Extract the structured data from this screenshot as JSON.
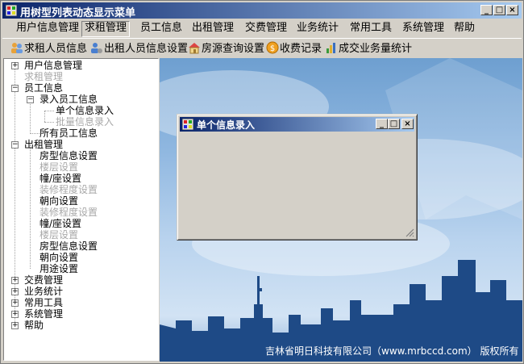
{
  "window": {
    "title": "用树型列表动态显示菜单"
  },
  "menu": [
    "用户信息管理",
    "求租管理",
    "员工信息",
    "出租管理",
    "交费管理",
    "业务统计",
    "常用工具",
    "系统管理",
    "帮助"
  ],
  "toolbar": [
    "求租人员信息",
    "出租人员信息设置",
    "房源查询设置",
    "收费记录",
    "成交业务量统计"
  ],
  "tree": [
    {
      "label": "用户信息管理",
      "disabled": false
    },
    {
      "label": "求租管理",
      "disabled": true
    },
    {
      "label": "员工信息",
      "disabled": false
    },
    {
      "label": "录入员工信息",
      "disabled": false
    },
    {
      "label": "单个信息录入",
      "disabled": false
    },
    {
      "label": "批量信息录入",
      "disabled": true
    },
    {
      "label": "所有员工信息",
      "disabled": false
    },
    {
      "label": "出租管理",
      "disabled": false
    },
    {
      "label": "房型信息设置",
      "disabled": false
    },
    {
      "label": "楼层设置",
      "disabled": true
    },
    {
      "label": "幢/座设置",
      "disabled": false
    },
    {
      "label": "装修程度设置",
      "disabled": true
    },
    {
      "label": "朝向设置",
      "disabled": false
    },
    {
      "label": "装修程度设置",
      "disabled": true
    },
    {
      "label": "幢/座设置",
      "disabled": false
    },
    {
      "label": "楼层设置",
      "disabled": true
    },
    {
      "label": "房型信息设置",
      "disabled": false
    },
    {
      "label": "朝向设置",
      "disabled": false
    },
    {
      "label": "用途设置",
      "disabled": false
    },
    {
      "label": "交费管理",
      "disabled": false
    },
    {
      "label": "业务统计",
      "disabled": false
    },
    {
      "label": "常用工具",
      "disabled": false
    },
    {
      "label": "系统管理",
      "disabled": false
    },
    {
      "label": "帮助",
      "disabled": false
    }
  ],
  "child_window": {
    "title": "单个信息录入"
  },
  "footer": "吉林省明日科技有限公司（www.mrbccd.com）  版权所有",
  "colors": {
    "titlebar": "#0a246a",
    "disabled_text": "#a8a8a8"
  }
}
